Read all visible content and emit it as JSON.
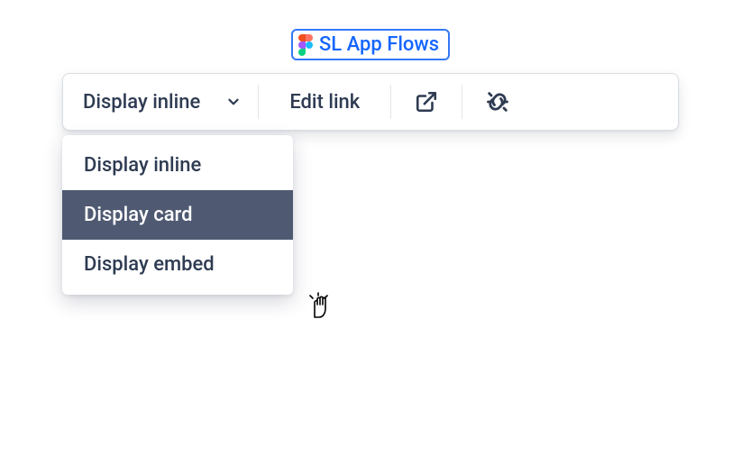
{
  "chip": {
    "label": "SL App Flows"
  },
  "toolbar": {
    "display_label": "Display inline",
    "edit_label": "Edit link"
  },
  "dropdown": {
    "items": [
      {
        "label": "Display inline"
      },
      {
        "label": "Display card"
      },
      {
        "label": "Display embed"
      }
    ],
    "hovered_index": 1
  }
}
